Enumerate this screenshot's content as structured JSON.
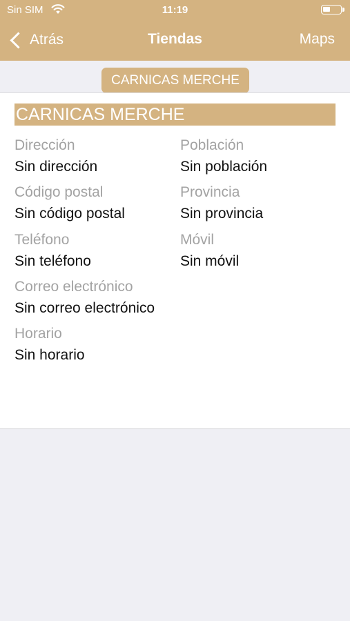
{
  "status_bar": {
    "carrier": "Sin SIM",
    "time": "11:19",
    "battery_level": 0.45
  },
  "nav": {
    "back_label": "Atrás",
    "title": "Tiendas",
    "right_label": "Maps"
  },
  "segment": {
    "label": "CARNICAS MERCHE"
  },
  "store": {
    "name": "CARNICAS MERCHE",
    "fields": {
      "direccion": {
        "label": "Dirección",
        "value": "Sin dirección"
      },
      "poblacion": {
        "label": "Población",
        "value": "Sin población"
      },
      "codigo_postal": {
        "label": "Código postal",
        "value": "Sin código postal"
      },
      "provincia": {
        "label": "Provincia",
        "value": "Sin provincia"
      },
      "telefono": {
        "label": "Teléfono",
        "value": "Sin teléfono"
      },
      "movil": {
        "label": "Móvil",
        "value": "Sin móvil"
      },
      "correo": {
        "label": "Correo electrónico",
        "value": "Sin correo electrónico"
      },
      "horario": {
        "label": "Horario",
        "value": "Sin horario"
      }
    }
  },
  "colors": {
    "accent": "#d4b381",
    "label_gray": "#a3a3a3",
    "background": "#efeff4"
  }
}
